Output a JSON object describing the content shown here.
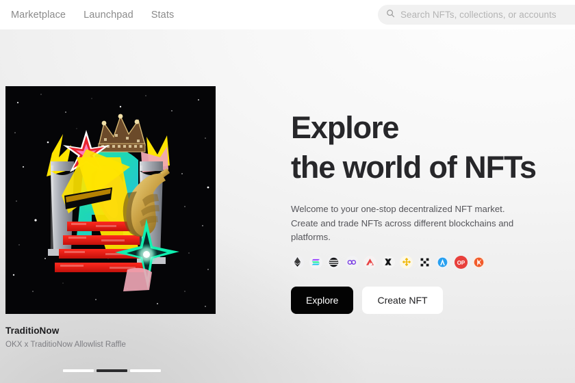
{
  "nav": {
    "items": [
      {
        "label": "Marketplace"
      },
      {
        "label": "Launchpad"
      },
      {
        "label": "Stats"
      }
    ]
  },
  "search": {
    "icon": "search-icon",
    "placeholder": "Search NFTs, collections, or accounts",
    "value": ""
  },
  "hero": {
    "title": "Explore\nthe world of NFTs",
    "title_line1": "Explore",
    "title_line2": "the world of NFTs",
    "description": "Welcome to your one-stop decentralized NFT market. Create and trade NFTs across different blockchains and platforms.",
    "buttons": [
      {
        "label": "Explore",
        "style": "primary"
      },
      {
        "label": "Create NFT",
        "style": "secondary"
      }
    ],
    "chains": [
      {
        "name": "ethereum",
        "color": "#f0f0f2"
      },
      {
        "name": "solana",
        "color": "#f2f2f4"
      },
      {
        "name": "sui",
        "color": "#f2f2f4"
      },
      {
        "name": "polygon",
        "color": "#f2f2f4"
      },
      {
        "name": "avalanche",
        "color": "#f5f3f3"
      },
      {
        "name": "x-layer",
        "color": "#f4f4f4"
      },
      {
        "name": "bnb-chain",
        "color": "#fbf8ec"
      },
      {
        "name": "starknet",
        "color": "#f3f3f3"
      },
      {
        "name": "arbitrum",
        "color": "#eef2f7"
      },
      {
        "name": "optimism",
        "color": "#e8403c"
      },
      {
        "name": "kaia",
        "color": "#f6efe9"
      }
    ]
  },
  "featured": {
    "title": "TraditioNow",
    "subtitle": "OKX x TraditioNow Allowlist Raffle",
    "artwork_alt": "Surreal collage: marble columns, jeweled crown, teal arch, yellow lightning bolts, red steps and a pointing golden hand on a starfield",
    "carousel": {
      "total": 3,
      "active_index": 1
    }
  },
  "colors": {
    "accent_dark": "#030303",
    "text_primary": "#27272a",
    "text_muted": "#7d7d82",
    "nav_text": "#8a8a8a",
    "search_bg": "#f1f1f1"
  }
}
